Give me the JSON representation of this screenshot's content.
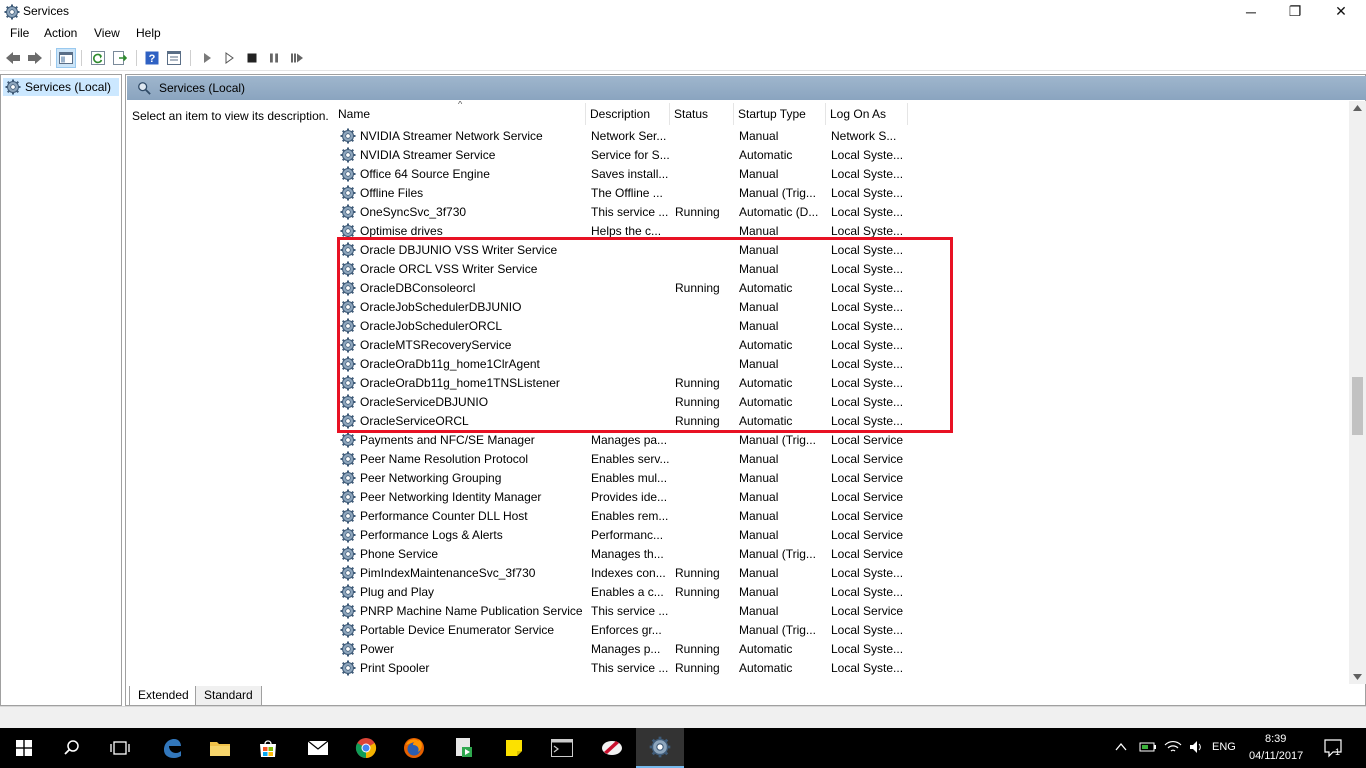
{
  "window": {
    "title": "Services",
    "minimize_glyph": "─",
    "restore_glyph": "❐",
    "close_glyph": "✕"
  },
  "menu": [
    "File",
    "Action",
    "View",
    "Help"
  ],
  "tree": {
    "root_label": "Services (Local)"
  },
  "pane": {
    "header": "Services (Local)",
    "description_prompt": "Select an item to view its description."
  },
  "columns": {
    "name": "Name",
    "description": "Description",
    "status": "Status",
    "startup": "Startup Type",
    "logon": "Log On As",
    "sort_glyph": "^"
  },
  "services": [
    {
      "name": "NVIDIA Streamer Network Service",
      "description": "Network Ser...",
      "status": "",
      "startup": "Manual",
      "logon": "Network S..."
    },
    {
      "name": "NVIDIA Streamer Service",
      "description": "Service for S...",
      "status": "",
      "startup": "Automatic",
      "logon": "Local Syste..."
    },
    {
      "name": "Office 64 Source Engine",
      "description": "Saves install...",
      "status": "",
      "startup": "Manual",
      "logon": "Local Syste..."
    },
    {
      "name": "Offline Files",
      "description": "The Offline ...",
      "status": "",
      "startup": "Manual (Trig...",
      "logon": "Local Syste..."
    },
    {
      "name": "OneSyncSvc_3f730",
      "description": "This service ...",
      "status": "Running",
      "startup": "Automatic (D...",
      "logon": "Local Syste..."
    },
    {
      "name": "Optimise drives",
      "description": "Helps the c...",
      "status": "",
      "startup": "Manual",
      "logon": "Local Syste..."
    },
    {
      "name": "Oracle DBJUNIO VSS Writer Service",
      "description": "",
      "status": "",
      "startup": "Manual",
      "logon": "Local Syste..."
    },
    {
      "name": "Oracle ORCL VSS Writer Service",
      "description": "",
      "status": "",
      "startup": "Manual",
      "logon": "Local Syste..."
    },
    {
      "name": "OracleDBConsoleorcl",
      "description": "",
      "status": "Running",
      "startup": "Automatic",
      "logon": "Local Syste..."
    },
    {
      "name": "OracleJobSchedulerDBJUNIO",
      "description": "",
      "status": "",
      "startup": "Manual",
      "logon": "Local Syste..."
    },
    {
      "name": "OracleJobSchedulerORCL",
      "description": "",
      "status": "",
      "startup": "Manual",
      "logon": "Local Syste..."
    },
    {
      "name": "OracleMTSRecoveryService",
      "description": "",
      "status": "",
      "startup": "Automatic",
      "logon": "Local Syste..."
    },
    {
      "name": "OracleOraDb11g_home1ClrAgent",
      "description": "",
      "status": "",
      "startup": "Manual",
      "logon": "Local Syste..."
    },
    {
      "name": "OracleOraDb11g_home1TNSListener",
      "description": "",
      "status": "Running",
      "startup": "Automatic",
      "logon": "Local Syste..."
    },
    {
      "name": "OracleServiceDBJUNIO",
      "description": "",
      "status": "Running",
      "startup": "Automatic",
      "logon": "Local Syste..."
    },
    {
      "name": "OracleServiceORCL",
      "description": "",
      "status": "Running",
      "startup": "Automatic",
      "logon": "Local Syste..."
    },
    {
      "name": "Payments and NFC/SE Manager",
      "description": "Manages pa...",
      "status": "",
      "startup": "Manual (Trig...",
      "logon": "Local Service"
    },
    {
      "name": "Peer Name Resolution Protocol",
      "description": "Enables serv...",
      "status": "",
      "startup": "Manual",
      "logon": "Local Service"
    },
    {
      "name": "Peer Networking Grouping",
      "description": "Enables mul...",
      "status": "",
      "startup": "Manual",
      "logon": "Local Service"
    },
    {
      "name": "Peer Networking Identity Manager",
      "description": "Provides ide...",
      "status": "",
      "startup": "Manual",
      "logon": "Local Service"
    },
    {
      "name": "Performance Counter DLL Host",
      "description": "Enables rem...",
      "status": "",
      "startup": "Manual",
      "logon": "Local Service"
    },
    {
      "name": "Performance Logs & Alerts",
      "description": "Performanc...",
      "status": "",
      "startup": "Manual",
      "logon": "Local Service"
    },
    {
      "name": "Phone Service",
      "description": "Manages th...",
      "status": "",
      "startup": "Manual (Trig...",
      "logon": "Local Service"
    },
    {
      "name": "PimIndexMaintenanceSvc_3f730",
      "description": "Indexes con...",
      "status": "Running",
      "startup": "Manual",
      "logon": "Local Syste..."
    },
    {
      "name": "Plug and Play",
      "description": "Enables a c...",
      "status": "Running",
      "startup": "Manual",
      "logon": "Local Syste..."
    },
    {
      "name": "PNRP Machine Name Publication Service",
      "description": "This service ...",
      "status": "",
      "startup": "Manual",
      "logon": "Local Service"
    },
    {
      "name": "Portable Device Enumerator Service",
      "description": "Enforces gr...",
      "status": "",
      "startup": "Manual (Trig...",
      "logon": "Local Syste..."
    },
    {
      "name": "Power",
      "description": "Manages p...",
      "status": "Running",
      "startup": "Automatic",
      "logon": "Local Syste..."
    },
    {
      "name": "Print Spooler",
      "description": "This service ...",
      "status": "Running",
      "startup": "Automatic",
      "logon": "Local Syste..."
    }
  ],
  "tabs": [
    "Extended",
    "Standard"
  ],
  "taskbar": {
    "language": "ENG",
    "time": "8:39",
    "date": "04/11/2017",
    "notification_count": "1"
  },
  "colors": {
    "highlight_box": "#e81123",
    "pane_header": "#9fb6cd",
    "taskbar": "#000000"
  }
}
